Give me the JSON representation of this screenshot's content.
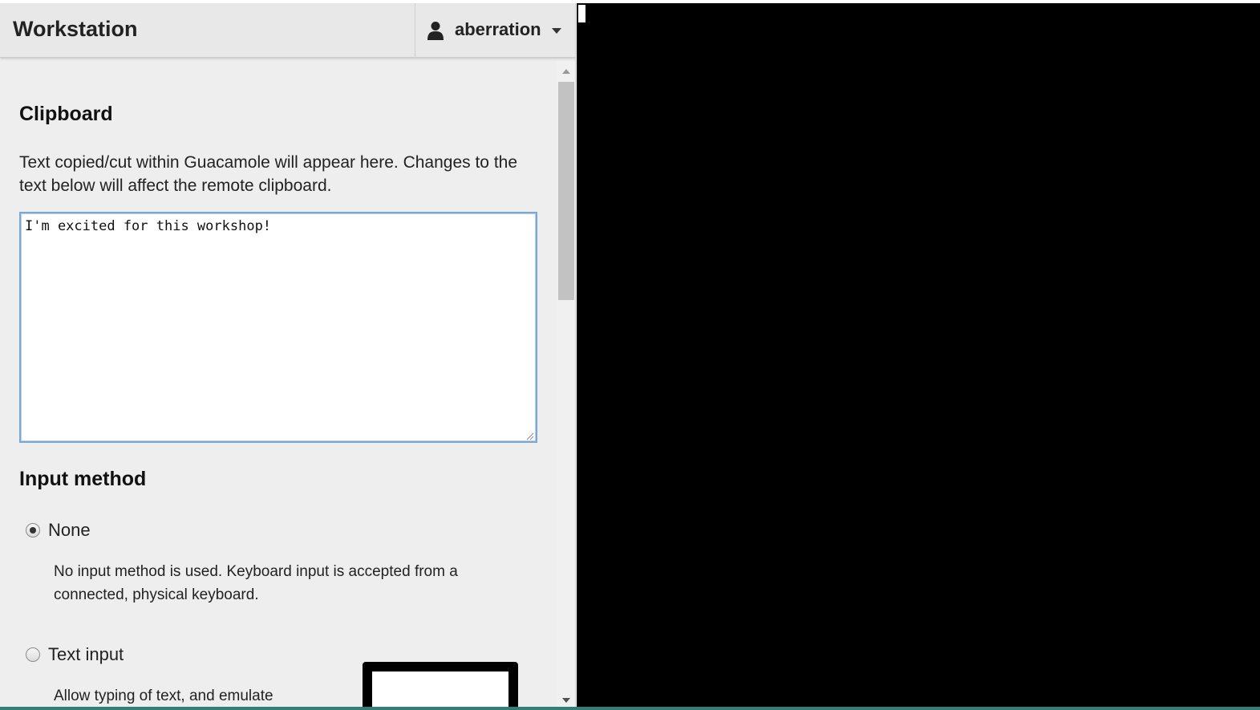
{
  "header": {
    "title": "Workstation",
    "user": {
      "name": "aberration",
      "icon": "user-icon",
      "dropdown_icon": "caret-down-icon"
    }
  },
  "clipboard": {
    "title": "Clipboard",
    "description": "Text copied/cut within Guacamole will appear here. Changes to the text below will affect the remote clipboard.",
    "value": "I'm excited for this workshop!"
  },
  "input_method": {
    "title": "Input method",
    "options": [
      {
        "label": "None",
        "selected": true,
        "description": "No input method is used. Keyboard input is accepted from a connected, physical keyboard."
      },
      {
        "label": "Text input",
        "selected": false,
        "description": "Allow typing of text, and emulate"
      }
    ]
  },
  "colors": {
    "menu_background": "#eeeeee",
    "header_background": "#e8e8e8",
    "textarea_focus_border": "#7aa7d6",
    "remote_background": "#000000",
    "bottom_strip": "#2f7f7a"
  }
}
